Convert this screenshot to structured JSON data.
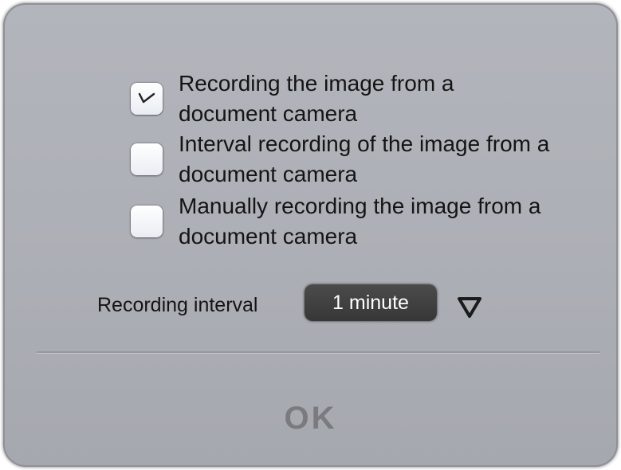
{
  "options": [
    {
      "label_line1": "Recording the image from a",
      "label_line2": "document camera",
      "checked": true
    },
    {
      "label_line1": "Interval recording of the image from a",
      "label_line2": "document camera",
      "checked": false
    },
    {
      "label_line1": "Manually recording the image from a",
      "label_line2": "document camera",
      "checked": false
    }
  ],
  "interval": {
    "label": "Recording interval",
    "value": "1 minute",
    "arrow_icon": "triangle-down-icon"
  },
  "ok_label": "OK",
  "colors": {
    "dialog_bg": "#afb1b8",
    "select_bg": "#3f3f3f",
    "ok_text": "#7b7b7f"
  }
}
